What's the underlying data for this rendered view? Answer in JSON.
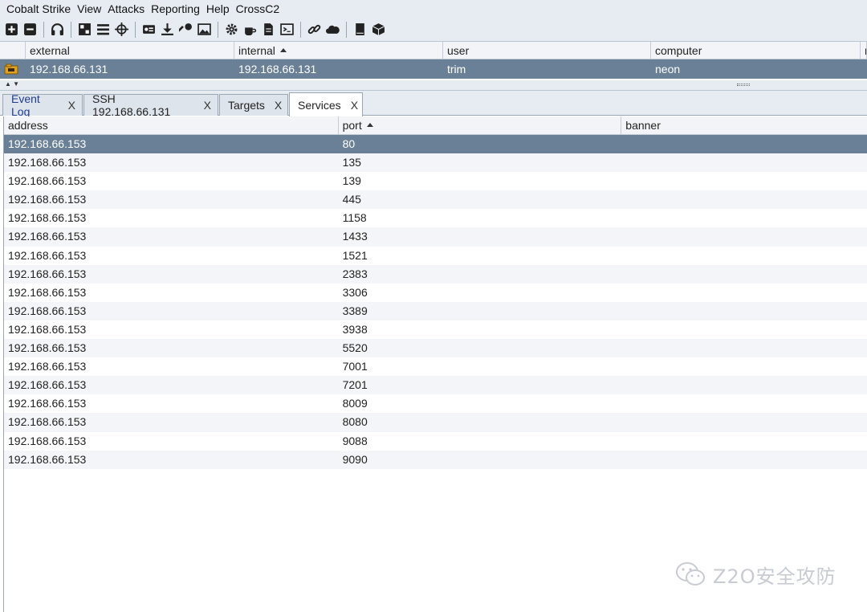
{
  "menu": [
    "Cobalt Strike",
    "View",
    "Attacks",
    "Reporting",
    "Help",
    "CrossC2"
  ],
  "toolbar": {
    "icons": [
      "plus-icon",
      "minus-icon",
      "headphones-icon",
      "pivot-graph-icon",
      "list-icon",
      "crosshair-icon",
      "credentials-icon",
      "download-icon",
      "key-icon",
      "image-icon",
      "gear-icon",
      "coffee-icon",
      "document-icon",
      "console-icon",
      "link-icon",
      "cloud-icon",
      "book-icon",
      "cube-icon"
    ]
  },
  "sessions": {
    "columns": [
      "external",
      "internal",
      "user",
      "computer",
      "n"
    ],
    "rows": [
      {
        "external": "192.168.66.131",
        "internal": "192.168.66.131",
        "user": "trim",
        "computer": "neon"
      }
    ]
  },
  "tabs": [
    {
      "label": "Event Log",
      "close": "X"
    },
    {
      "label": "SSH 192.168.66.131",
      "close": "X"
    },
    {
      "label": "Targets",
      "close": "X"
    },
    {
      "label": "Services",
      "close": "X"
    }
  ],
  "services": {
    "columns": [
      "address",
      "port",
      "banner"
    ],
    "rows": [
      {
        "address": "192.168.66.153",
        "port": "80",
        "banner": ""
      },
      {
        "address": "192.168.66.153",
        "port": "135",
        "banner": ""
      },
      {
        "address": "192.168.66.153",
        "port": "139",
        "banner": ""
      },
      {
        "address": "192.168.66.153",
        "port": "445",
        "banner": ""
      },
      {
        "address": "192.168.66.153",
        "port": "1158",
        "banner": ""
      },
      {
        "address": "192.168.66.153",
        "port": "1433",
        "banner": ""
      },
      {
        "address": "192.168.66.153",
        "port": "1521",
        "banner": ""
      },
      {
        "address": "192.168.66.153",
        "port": "2383",
        "banner": ""
      },
      {
        "address": "192.168.66.153",
        "port": "3306",
        "banner": ""
      },
      {
        "address": "192.168.66.153",
        "port": "3389",
        "banner": ""
      },
      {
        "address": "192.168.66.153",
        "port": "3938",
        "banner": ""
      },
      {
        "address": "192.168.66.153",
        "port": "5520",
        "banner": ""
      },
      {
        "address": "192.168.66.153",
        "port": "7001",
        "banner": ""
      },
      {
        "address": "192.168.66.153",
        "port": "7201",
        "banner": ""
      },
      {
        "address": "192.168.66.153",
        "port": "8009",
        "banner": ""
      },
      {
        "address": "192.168.66.153",
        "port": "8080",
        "banner": ""
      },
      {
        "address": "192.168.66.153",
        "port": "9088",
        "banner": ""
      },
      {
        "address": "192.168.66.153",
        "port": "9090",
        "banner": ""
      }
    ]
  },
  "watermark": {
    "text": "Z2O安全攻防"
  },
  "colors": {
    "selection": "#6a8096",
    "chrome": "#e6ecf2"
  }
}
